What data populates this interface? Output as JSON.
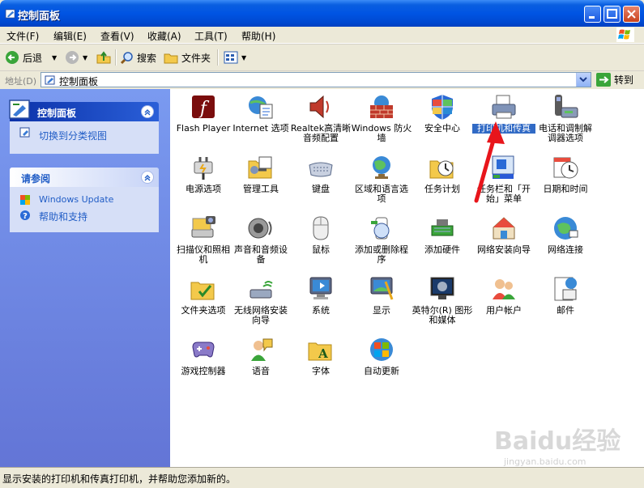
{
  "window": {
    "title": "控制面板"
  },
  "menu": [
    {
      "label": "文件(F)"
    },
    {
      "label": "编辑(E)"
    },
    {
      "label": "查看(V)"
    },
    {
      "label": "收藏(A)"
    },
    {
      "label": "工具(T)"
    },
    {
      "label": "帮助(H)"
    }
  ],
  "toolbar": {
    "back": "后退",
    "search": "搜索",
    "folders": "文件夹"
  },
  "address": {
    "label": "地址(D)",
    "value": "控制面板",
    "go": "转到"
  },
  "left_pane": {
    "control_panel": {
      "title": "控制面板",
      "switch_view": "切换到分类视图"
    },
    "see_also": {
      "title": "请参阅",
      "links": [
        "Windows Update",
        "帮助和支持"
      ]
    }
  },
  "items": [
    {
      "label": "Flash Player",
      "icon": "flash-icon"
    },
    {
      "label": "Internet 选项",
      "icon": "internet-options-icon"
    },
    {
      "label": "Realtek高清晰音频配置",
      "icon": "realtek-audio-icon"
    },
    {
      "label": "Windows 防火墙",
      "icon": "firewall-icon"
    },
    {
      "label": "安全中心",
      "icon": "security-center-icon"
    },
    {
      "label": "打印机和传真",
      "icon": "printer-icon"
    },
    {
      "label": "电话和调制解调器选项",
      "icon": "phone-modem-icon"
    },
    {
      "label": "电源选项",
      "icon": "power-icon"
    },
    {
      "label": "管理工具",
      "icon": "admin-tools-icon"
    },
    {
      "label": "键盘",
      "icon": "keyboard-icon"
    },
    {
      "label": "区域和语言选项",
      "icon": "region-icon"
    },
    {
      "label": "任务计划",
      "icon": "scheduled-tasks-icon"
    },
    {
      "label": "任务栏和「开始」菜单",
      "icon": "taskbar-icon"
    },
    {
      "label": "日期和时间",
      "icon": "datetime-icon"
    },
    {
      "label": "扫描仪和照相机",
      "icon": "scanner-icon"
    },
    {
      "label": "声音和音频设备",
      "icon": "sound-icon"
    },
    {
      "label": "鼠标",
      "icon": "mouse-icon"
    },
    {
      "label": "添加或删除程序",
      "icon": "add-remove-icon"
    },
    {
      "label": "添加硬件",
      "icon": "add-hardware-icon"
    },
    {
      "label": "网络安装向导",
      "icon": "network-wizard-icon"
    },
    {
      "label": "网络连接",
      "icon": "network-connections-icon"
    },
    {
      "label": "文件夹选项",
      "icon": "folder-options-icon"
    },
    {
      "label": "无线网络安装向导",
      "icon": "wireless-icon"
    },
    {
      "label": "系统",
      "icon": "system-icon"
    },
    {
      "label": "显示",
      "icon": "display-icon"
    },
    {
      "label": "英特尔(R) 图形和媒体",
      "icon": "intel-graphics-icon"
    },
    {
      "label": "用户帐户",
      "icon": "user-accounts-icon"
    },
    {
      "label": "邮件",
      "icon": "mail-icon"
    },
    {
      "label": "游戏控制器",
      "icon": "game-controller-icon"
    },
    {
      "label": "语音",
      "icon": "speech-icon"
    },
    {
      "label": "字体",
      "icon": "fonts-icon"
    },
    {
      "label": "自动更新",
      "icon": "auto-update-icon"
    }
  ],
  "selected_item": "打印机和传真",
  "status": "显示安装的打印机和传真打印机，并帮助您添加新的。",
  "watermark": {
    "brand": "Baidu经验",
    "url": "jingyan.baidu.com"
  },
  "colors": {
    "title_bar": "#0054e3",
    "left_pane": "#6f8ae3",
    "selection": "#316ac5",
    "arrow": "#e8151b"
  }
}
